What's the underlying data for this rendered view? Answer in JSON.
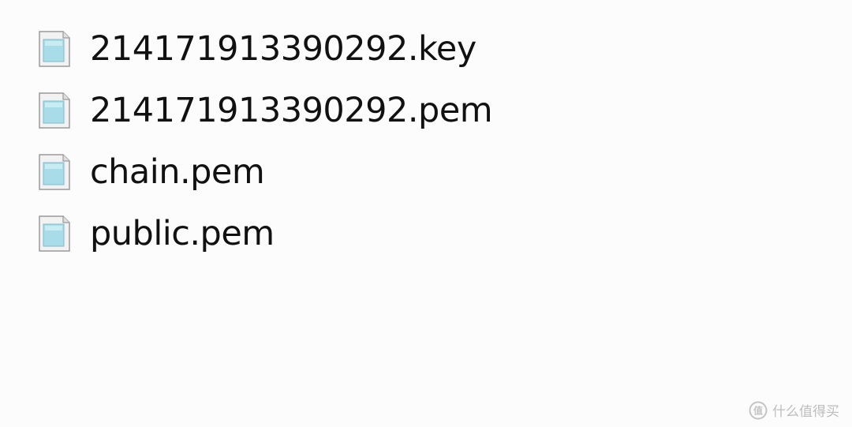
{
  "files": [
    {
      "name": "214171913390292.key",
      "icon": "document-file-icon"
    },
    {
      "name": "214171913390292.pem",
      "icon": "document-file-icon"
    },
    {
      "name": "chain.pem",
      "icon": "document-file-icon"
    },
    {
      "name": "public.pem",
      "icon": "document-file-icon"
    }
  ],
  "watermark": {
    "text": "什么值得买",
    "icon": "smzdm-logo-icon"
  },
  "colors": {
    "background": "#fcfcfc",
    "text": "#111111",
    "icon_fill": "#a8dce8",
    "watermark": "#bdbdbd"
  }
}
